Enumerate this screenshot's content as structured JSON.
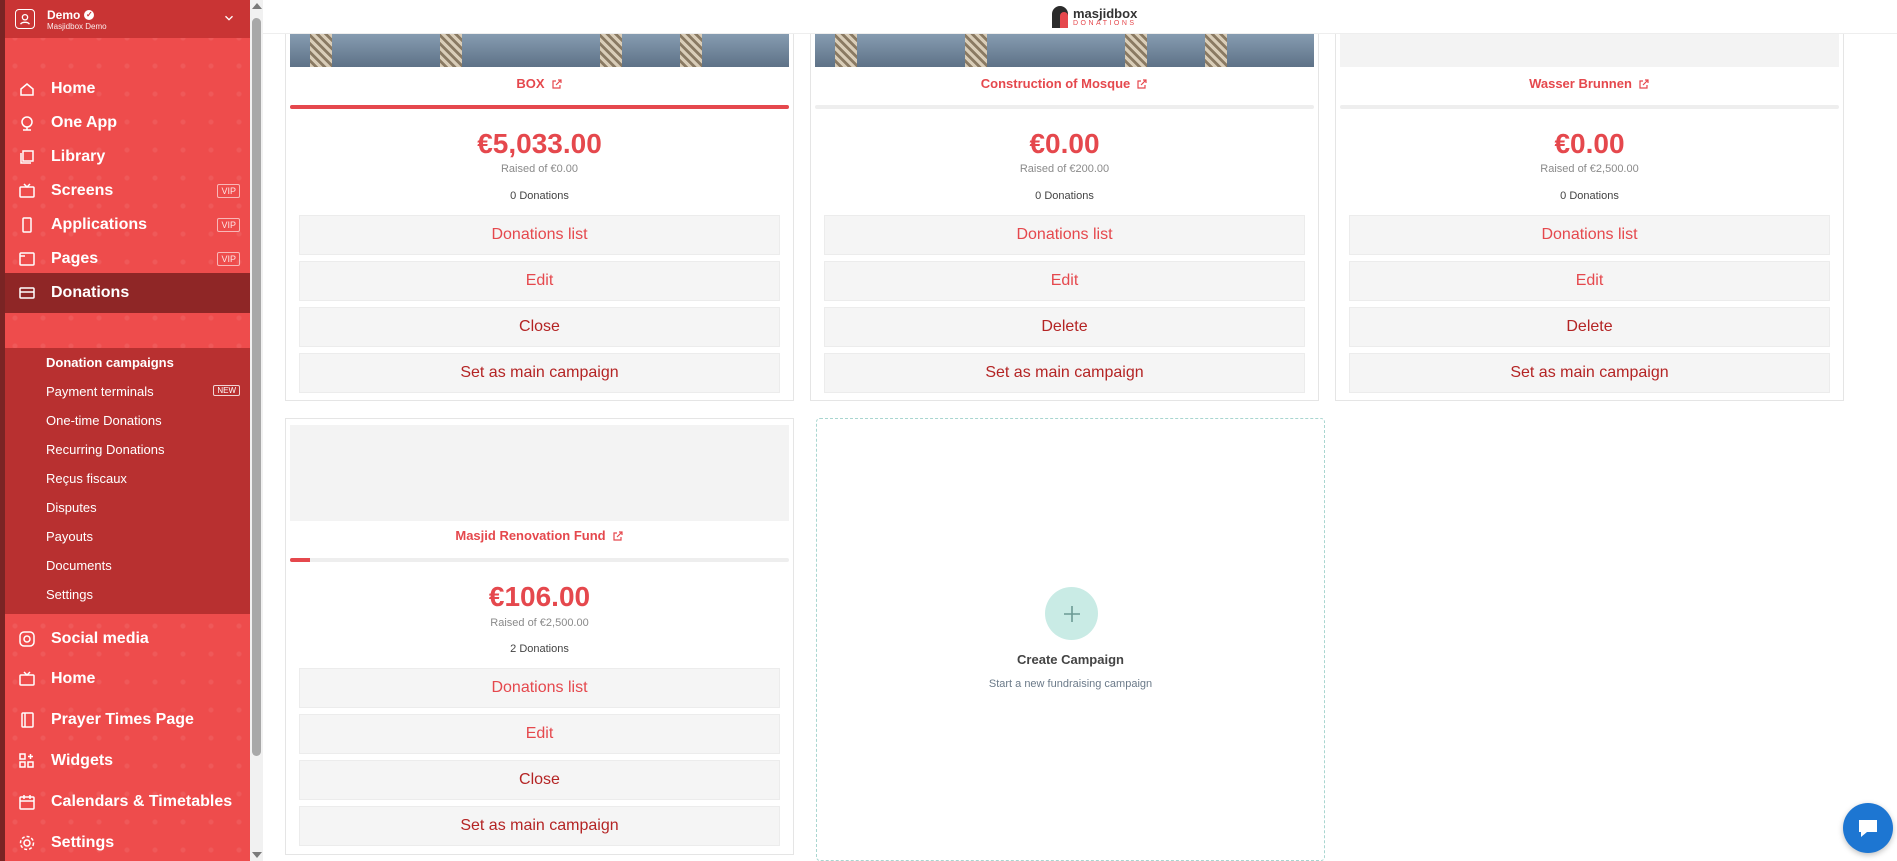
{
  "account": {
    "name": "Demo",
    "subtitle": "Masjidbox Demo"
  },
  "nav_top": [
    {
      "label": "Home",
      "icon": "home-icon"
    },
    {
      "label": "One App",
      "icon": "globe-icon"
    },
    {
      "label": "Library",
      "icon": "library-icon"
    },
    {
      "label": "Screens",
      "icon": "tv-icon",
      "badge": "VIP"
    },
    {
      "label": "Applications",
      "icon": "phone-icon",
      "badge": "VIP"
    },
    {
      "label": "Pages",
      "icon": "browser-icon",
      "badge": "VIP"
    },
    {
      "label": "Donations",
      "icon": "card-icon"
    }
  ],
  "donations_sub": [
    {
      "label": "Donation campaigns"
    },
    {
      "label": "Payment terminals",
      "badge": "NEW"
    },
    {
      "label": "One-time Donations"
    },
    {
      "label": "Recurring Donations"
    },
    {
      "label": "Reçus fiscaux"
    },
    {
      "label": "Disputes"
    },
    {
      "label": "Payouts"
    },
    {
      "label": "Documents"
    },
    {
      "label": "Settings"
    }
  ],
  "nav_bottom": [
    {
      "label": "Social media",
      "icon": "instagram-icon"
    },
    {
      "label": "Home",
      "icon": "tv-icon"
    },
    {
      "label": "Prayer Times Page",
      "icon": "book-icon"
    },
    {
      "label": "Widgets",
      "icon": "widgets-icon"
    },
    {
      "label": "Calendars & Timetables",
      "icon": "calendar-icon"
    },
    {
      "label": "Settings",
      "icon": "gear-icon"
    }
  ],
  "logo": {
    "brand": "masjidbox",
    "tag": "DONATIONS"
  },
  "campaigns": [
    {
      "title": "BOX",
      "amount": "€5,033.00",
      "raised": "Raised of €0.00",
      "count": "0 Donations",
      "progress": 1.0,
      "buttons": [
        "Donations list",
        "Edit",
        "Close",
        "Set as main campaign"
      ]
    },
    {
      "title": "Construction of Mosque",
      "amount": "€0.00",
      "raised": "Raised of €200.00",
      "count": "0 Donations",
      "progress": 0.0,
      "buttons": [
        "Donations list",
        "Edit",
        "Delete",
        "Set as main campaign"
      ]
    },
    {
      "title": "Wasser Brunnen",
      "amount": "€0.00",
      "raised": "Raised of €2,500.00",
      "count": "0 Donations",
      "progress": 0.0,
      "buttons": [
        "Donations list",
        "Edit",
        "Delete",
        "Set as main campaign"
      ]
    },
    {
      "title": "Masjid Renovation Fund",
      "amount": "€106.00",
      "raised": "Raised of €2,500.00",
      "count": "2 Donations",
      "progress": 0.04,
      "buttons": [
        "Donations list",
        "Edit",
        "Close",
        "Set as main campaign"
      ]
    }
  ],
  "create": {
    "title": "Create Campaign",
    "subtitle": "Start a new fundraising campaign"
  },
  "colors": {
    "sidebar": "#ee4c4c",
    "accent": "#e5484d",
    "active": "#8f2626"
  }
}
